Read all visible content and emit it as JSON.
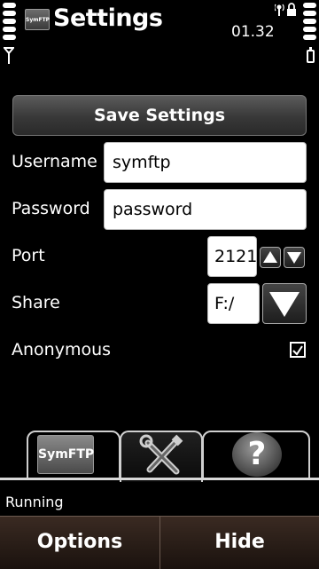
{
  "header": {
    "app_icon_label": "SymFTP",
    "title": "Settings",
    "clock": "01.32"
  },
  "toolbar": {
    "save_label": "Save Settings"
  },
  "form": {
    "username_label": "Username",
    "username_value": "symftp",
    "password_label": "Password",
    "password_value": "password",
    "port_label": "Port",
    "port_value": "2121",
    "share_label": "Share",
    "share_value": "F:/",
    "anonymous_label": "Anonymous",
    "anonymous_checked": true
  },
  "tabs": {
    "ftp_label": "SymFTP",
    "help_glyph": "?"
  },
  "status": {
    "text": "Running"
  },
  "softkeys": {
    "left": "Options",
    "right": "Hide"
  },
  "colors": {
    "background": "#000000",
    "softkey_bar": "#2a1c16",
    "field_bg": "#ffffff"
  }
}
